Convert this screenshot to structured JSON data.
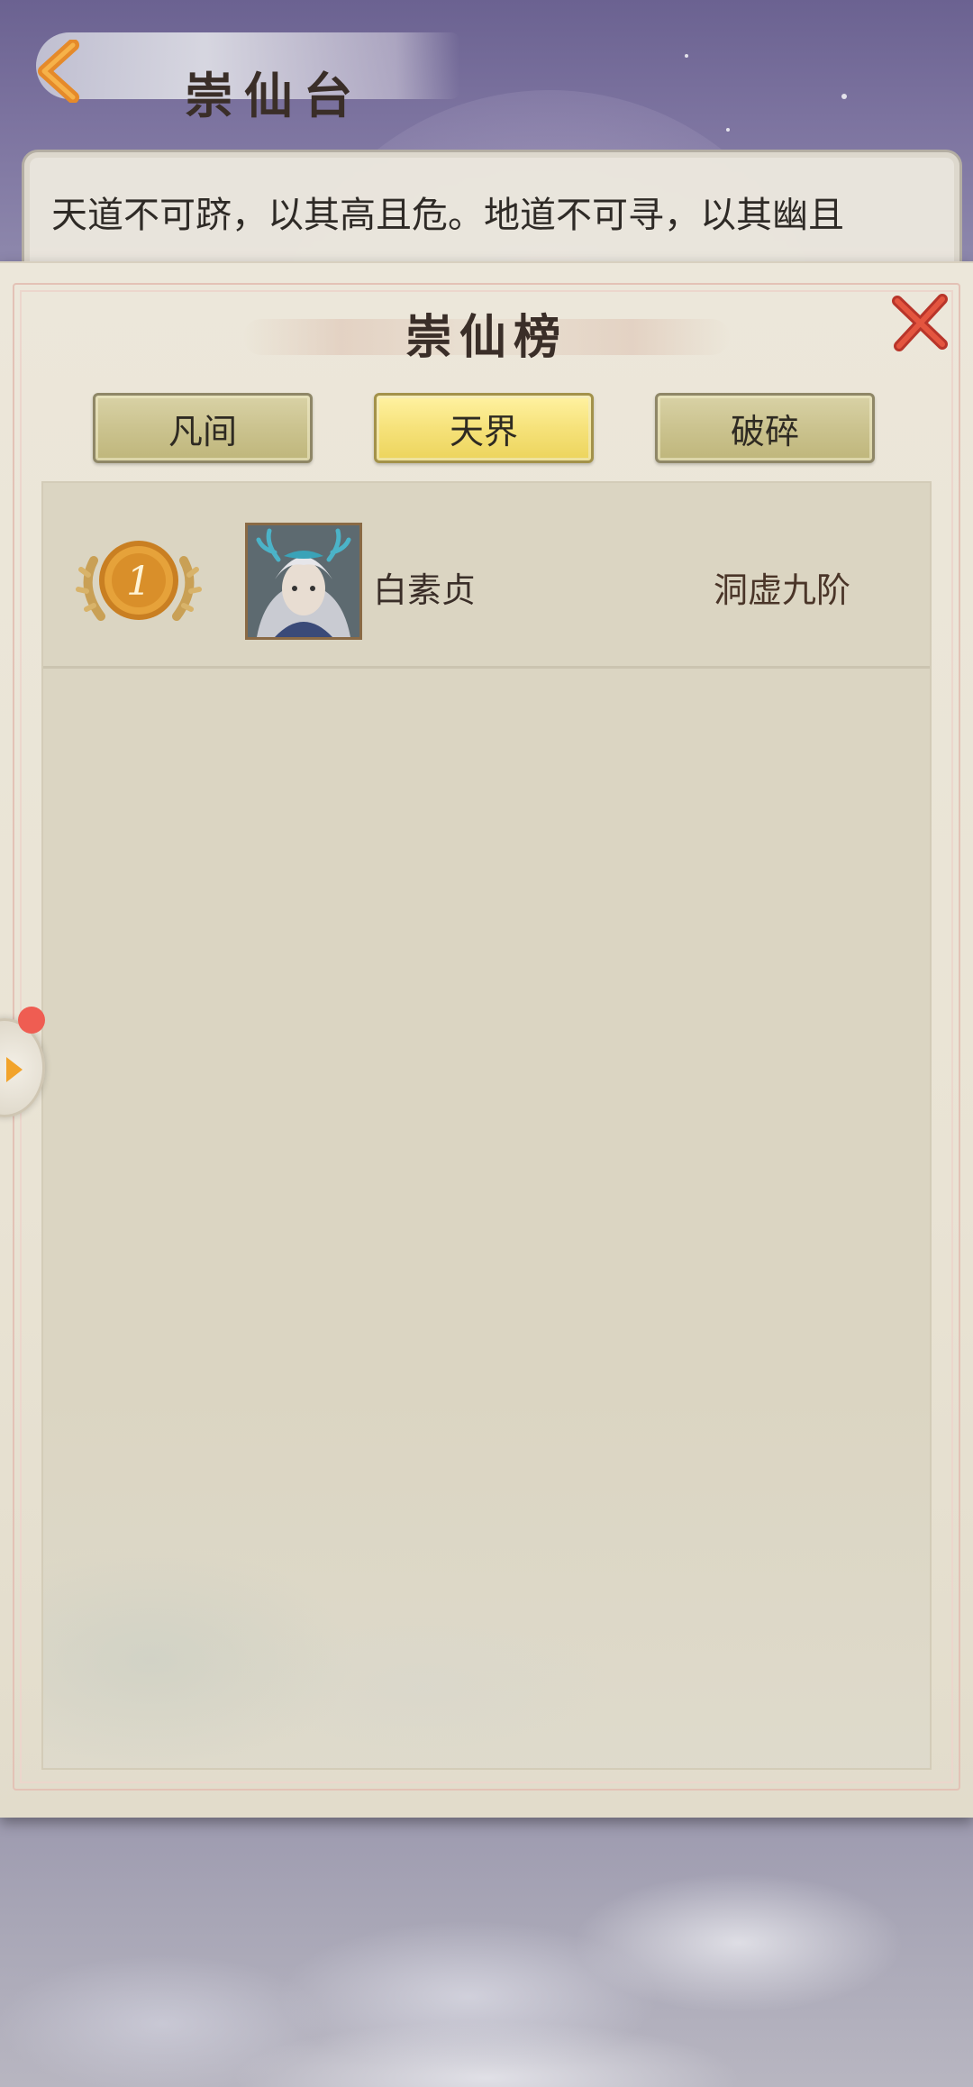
{
  "page": {
    "title": "崇仙台",
    "intro_text": "天道不可跻，以其高且危。地道不可寻，以其幽且"
  },
  "modal": {
    "title": "崇仙榜",
    "tabs": [
      {
        "label": "凡间",
        "active": false
      },
      {
        "label": "天界",
        "active": true
      },
      {
        "label": "破碎",
        "active": false
      }
    ],
    "rankings": [
      {
        "rank": "1",
        "name": "白素贞",
        "realm": "洞虚九阶"
      }
    ]
  },
  "colors": {
    "accent_gold": "#f6e27a",
    "close_red": "#d9493a",
    "back_orange": "#e58a2a",
    "notification_red": "#ef5d52"
  },
  "icons": {
    "back": "chevron-left-icon",
    "close": "close-icon",
    "rank": "rank-medal-icon",
    "side": "arrow-right-icon"
  }
}
